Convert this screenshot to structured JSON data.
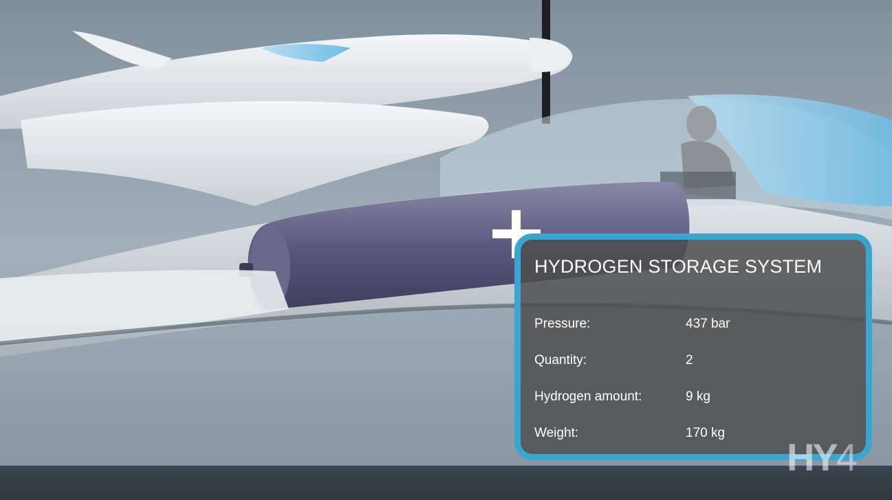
{
  "panel": {
    "title": "HYDROGEN STORAGE SYSTEM",
    "specs": [
      {
        "label": "Pressure:",
        "value": "437 bar"
      },
      {
        "label": "Quantity:",
        "value": "2"
      },
      {
        "label": "Hydrogen amount:",
        "value": "9 kg"
      },
      {
        "label": "Weight:",
        "value": "170 kg"
      }
    ]
  },
  "logo": {
    "text_main": "HY",
    "text_number": "4"
  },
  "colors": {
    "panel_border": "#3aa6cf",
    "panel_fill": "#4e4e4e",
    "tank": "#5c5a7c",
    "canopy": "#7fc4e6"
  }
}
